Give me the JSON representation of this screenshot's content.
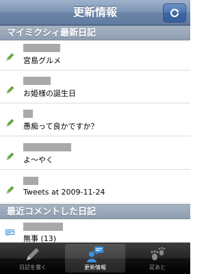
{
  "navbar": {
    "title": "更新情報",
    "refresh_icon": "refresh-icon"
  },
  "sections": [
    {
      "title": "マイミクシィ最新日記"
    },
    {
      "title": "最近コメントした日記"
    }
  ],
  "diary_rows": [
    {
      "title": "宮島グルメ"
    },
    {
      "title": "お姫様の誕生日"
    },
    {
      "title": "愚痴って良かですか？"
    },
    {
      "title": "よ～やく"
    },
    {
      "title": "Tweets at 2009-11-24"
    }
  ],
  "comment_rows": [
    {
      "title": "無事 (13)"
    }
  ],
  "tabbar": {
    "tabs": [
      {
        "label": "日記を書く",
        "icon": "pencil-icon"
      },
      {
        "label": "更新情報",
        "icon": "update-icon",
        "active": true
      },
      {
        "label": "足あと",
        "icon": "footprint-icon"
      }
    ]
  },
  "colors": {
    "accent": "#6d87a9",
    "section": "#97a6b8",
    "tabbar": "#1a1a1a"
  }
}
